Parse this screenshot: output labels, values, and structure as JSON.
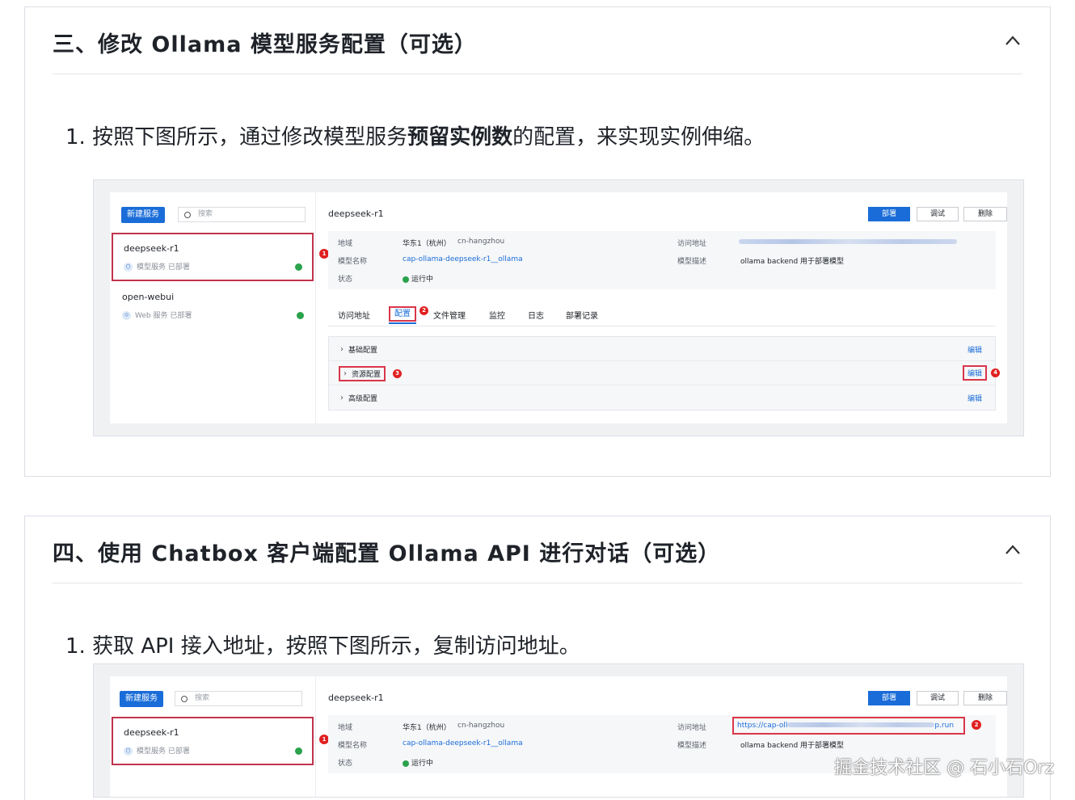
{
  "sections": [
    {
      "title": "三、修改 Ollama 模型服务配置（可选）",
      "step": {
        "prefix": "1. 按照下图所示，通过修改模型服务",
        "bold": "预留实例数",
        "suffix": "的配置，来实现实例伸缩。"
      },
      "shot": {
        "new_service": "新建服务",
        "search_placeholder": "搜索",
        "services": [
          {
            "name": "deepseek-r1",
            "icon_glyph": "⬡",
            "type": "模型服务",
            "status": "已部署"
          },
          {
            "name": "open-webui",
            "icon_glyph": "⟐",
            "type": "Web 服务",
            "status": "已部署"
          }
        ],
        "title": "deepseek-r1",
        "buttons": {
          "deploy": "部署",
          "debug": "调试",
          "delete": "删除"
        },
        "info": {
          "region_key": "地域",
          "region_val": "华东1（杭州）",
          "region_code": "cn-hangzhou",
          "model_key": "模型名称",
          "model_val": "cap-ollama-deepseek-r1__ollama",
          "status_key": "状态",
          "status_val": "运行中",
          "url_key": "访问地址",
          "desc_key": "模型描述",
          "desc_val": "ollama backend 用于部署模型"
        },
        "tabs": [
          "访问地址",
          "配置",
          "文件管理",
          "监控",
          "日志",
          "部署记录"
        ],
        "config_rows": [
          {
            "label": "基础配置",
            "edit": "编辑"
          },
          {
            "label": "资源配置",
            "edit": "编辑"
          },
          {
            "label": "高级配置",
            "edit": "编辑"
          }
        ],
        "marks": [
          "1",
          "2",
          "3",
          "4"
        ]
      }
    },
    {
      "title": "四、使用 Chatbox 客户端配置 Ollama API 进行对话（可选）",
      "step": {
        "text": "1. 获取 API 接入地址，按照下图所示，复制访问地址。"
      },
      "shot": {
        "new_service": "新建服务",
        "search_placeholder": "搜索",
        "service": {
          "name": "deepseek-r1",
          "icon_glyph": "⬡",
          "type": "模型服务",
          "status": "已部署"
        },
        "title": "deepseek-r1",
        "buttons": {
          "deploy": "部署",
          "debug": "调试",
          "delete": "删除"
        },
        "info": {
          "region_key": "地域",
          "region_val": "华东1（杭州）",
          "region_code": "cn-hangzhou",
          "model_key": "模型名称",
          "model_val": "cap-ollama-deepseek-r1__ollama",
          "status_key": "状态",
          "status_val": "运行中",
          "url_key": "访问地址",
          "url_start": "https://cap-oll",
          "url_end": "p.run",
          "desc_key": "模型描述",
          "desc_val": "ollama backend 用于部署模型"
        },
        "marks": [
          "1",
          "2"
        ]
      }
    }
  ],
  "watermark": "掘金技术社区 @ 石小石Orz",
  "colors": {
    "accent": "#1a6dd8",
    "highlight": "#d9364a",
    "ok": "#2ba24c"
  }
}
